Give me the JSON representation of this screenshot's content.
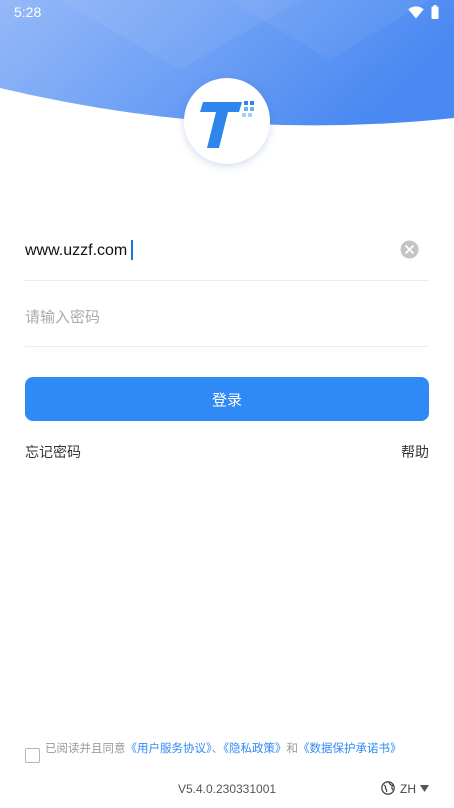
{
  "status_bar": {
    "time": "5:28",
    "icons": [
      "wifi-icon",
      "battery-icon"
    ]
  },
  "theme": {
    "header_gradient": [
      "#8fb4f7",
      "#4f8df3"
    ],
    "accent": "#2f8af5",
    "link": "#2f8af5"
  },
  "logo": {
    "icon": "app-logo-icon"
  },
  "login_form": {
    "username_value": "www.uzzf.com",
    "clear_icon": "clear-icon",
    "password_placeholder": "请输入密码",
    "login_label": "登录",
    "forgot_password": "忘记密码",
    "help": "帮助"
  },
  "agreement": {
    "checked": false,
    "prefix": "已阅读并且同意",
    "user_agreement": "《用户服务协议》",
    "sep1": "、",
    "privacy_policy": "《隐私政策》",
    "sep2": "和",
    "data_protection": "《数据保护承诺书》"
  },
  "footer": {
    "version": "V5.4.0.230331001",
    "language": "ZH",
    "language_icon": "globe-icon"
  }
}
